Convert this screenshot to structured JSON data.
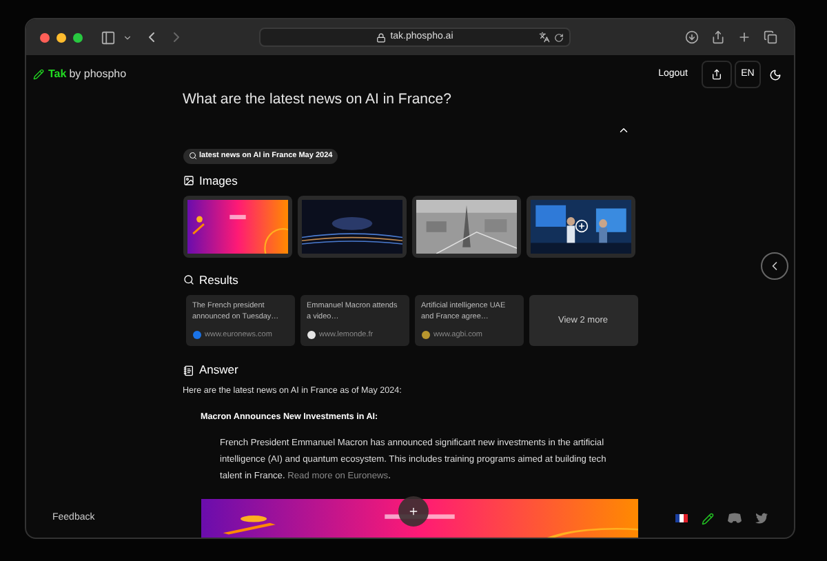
{
  "browser": {
    "url": "tak.phospho.ai"
  },
  "header": {
    "brand": "Tak",
    "brand_suffix": "by phospho",
    "logout": "Logout",
    "language": "EN"
  },
  "question": "What are the latest news on AI in France?",
  "search_query": "latest news on AI in France May 2024",
  "images": {
    "title": "Images",
    "items": [
      {
        "kind": "picture",
        "more": false
      },
      {
        "kind": "picture",
        "more": false
      },
      {
        "kind": "picture",
        "more": false
      },
      {
        "kind": "picture",
        "more": true
      }
    ]
  },
  "results": {
    "title": "Results",
    "items": [
      {
        "snippet": "The French president announced on Tuesday…",
        "source": "www.euronews.com",
        "color": "#1a73e8"
      },
      {
        "snippet": "Emmanuel Macron attends a video…",
        "source": "www.lemonde.fr",
        "color": "#e5e5e5"
      },
      {
        "snippet": "Artificial intelligence UAE and France agree…",
        "source": "www.agbi.com",
        "color": "#b8962e"
      }
    ],
    "more": "View 2 more"
  },
  "answer": {
    "title": "Answer",
    "intro": "Here are the latest news on AI in France as of May 2024:",
    "heading": "Macron Announces New Investments in AI:",
    "body": "French President Emmanuel Macron has announced significant new investments in the artificial intelligence (AI) and quantum ecosystem. This includes training programs aimed at building tech talent in France.",
    "link": "Read more on Euronews",
    "link_end": "."
  },
  "footer": {
    "feedback": "Feedback"
  }
}
